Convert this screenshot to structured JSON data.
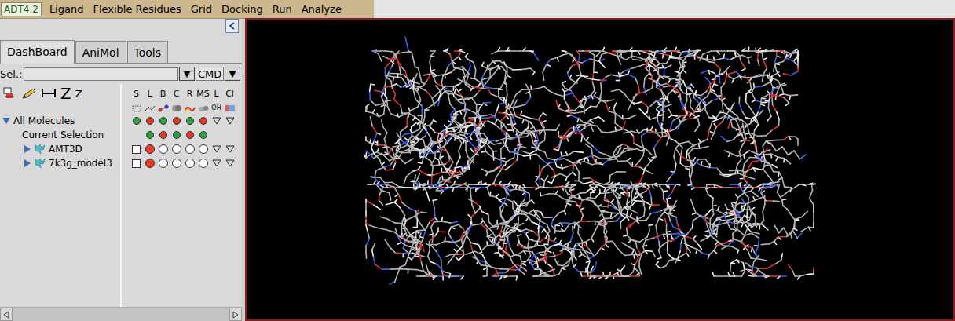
{
  "menubar": {
    "app": "ADT4.2",
    "items": [
      "Ligand",
      "Flexible Residues",
      "Grid",
      "Docking",
      "Run",
      "Analyze"
    ]
  },
  "tabs": [
    {
      "label": "DashBoard",
      "selected": true
    },
    {
      "label": "AniMol",
      "selected": false
    },
    {
      "label": "Tools",
      "selected": false
    }
  ],
  "selection_bar": {
    "label": "Sel.:",
    "value": "",
    "arrow": "▼",
    "mode": "CMD",
    "mode_arrow": "▼"
  },
  "toolbar": {
    "texts": [
      "Z",
      "Z"
    ]
  },
  "columns": [
    {
      "label": "S",
      "sub": ""
    },
    {
      "label": "L",
      "sub": ""
    },
    {
      "label": "B",
      "sub": ""
    },
    {
      "label": "C",
      "sub": ""
    },
    {
      "label": "R",
      "sub": ""
    },
    {
      "label": "MS",
      "sub": ""
    },
    {
      "label": "L",
      "sub": "OH"
    },
    {
      "label": "Cl",
      "sub": ""
    }
  ],
  "tree": [
    {
      "label": "All Molecules",
      "level": 0,
      "toggle": true,
      "expanded": true,
      "molecule": false,
      "selected": false,
      "cells": [
        {
          "kind": "dot",
          "color": "#2f9e3a"
        },
        {
          "kind": "dot",
          "color": "#e03a2a"
        },
        {
          "kind": "dot",
          "color": "#2f9e3a"
        },
        {
          "kind": "dot",
          "color": "#e03a2a"
        },
        {
          "kind": "dot",
          "color": "#2f9e3a"
        },
        {
          "kind": "dot",
          "color": "#e03a2a"
        },
        {
          "kind": "menu"
        },
        {
          "kind": "menu"
        }
      ]
    },
    {
      "label": "Current Selection",
      "level": 1,
      "toggle": false,
      "expanded": false,
      "molecule": false,
      "selected": false,
      "cells": [
        {
          "kind": "blank"
        },
        {
          "kind": "dot",
          "color": "#2f9e3a"
        },
        {
          "kind": "dot",
          "color": "#e03a2a"
        },
        {
          "kind": "dot",
          "color": "#2f9e3a"
        },
        {
          "kind": "dot",
          "color": "#e03a2a"
        },
        {
          "kind": "dot",
          "color": "#2f9e3a"
        },
        {
          "kind": "blank"
        },
        {
          "kind": "blank"
        }
      ]
    },
    {
      "label": "AMT3D",
      "level": 1,
      "toggle": true,
      "expanded": false,
      "molecule": true,
      "selected": false,
      "cells": [
        {
          "kind": "box",
          "checked": false
        },
        {
          "kind": "ring",
          "on": true
        },
        {
          "kind": "ring",
          "on": false
        },
        {
          "kind": "ring",
          "on": false
        },
        {
          "kind": "ring",
          "on": false
        },
        {
          "kind": "ring",
          "on": false
        },
        {
          "kind": "menu"
        },
        {
          "kind": "menu"
        }
      ]
    },
    {
      "label": "7k3g_model3",
      "level": 1,
      "toggle": true,
      "expanded": false,
      "molecule": true,
      "selected": false,
      "cells": [
        {
          "kind": "box",
          "checked": false
        },
        {
          "kind": "ring",
          "on": true
        },
        {
          "kind": "ring",
          "on": false
        },
        {
          "kind": "ring",
          "on": false
        },
        {
          "kind": "ring",
          "on": false
        },
        {
          "kind": "ring",
          "on": false
        },
        {
          "kind": "menu"
        },
        {
          "kind": "menu"
        }
      ]
    }
  ]
}
